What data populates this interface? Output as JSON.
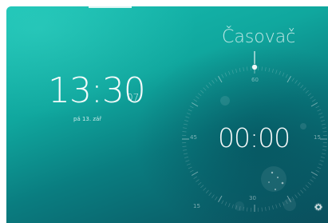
{
  "app": {
    "clock": {
      "time": "13:30",
      "seconds": "07",
      "date": "pá 13. zář"
    },
    "timer": {
      "title": "Časovač",
      "display": "00:00",
      "dial_labels": {
        "top": "60",
        "left": "45",
        "right": "15",
        "bottom": "30",
        "bottom_left": "15"
      }
    },
    "icons": {
      "top_indicator": "page-indicator",
      "dial_handle": "timer-handle-icon",
      "settings": "settings-icon"
    }
  }
}
